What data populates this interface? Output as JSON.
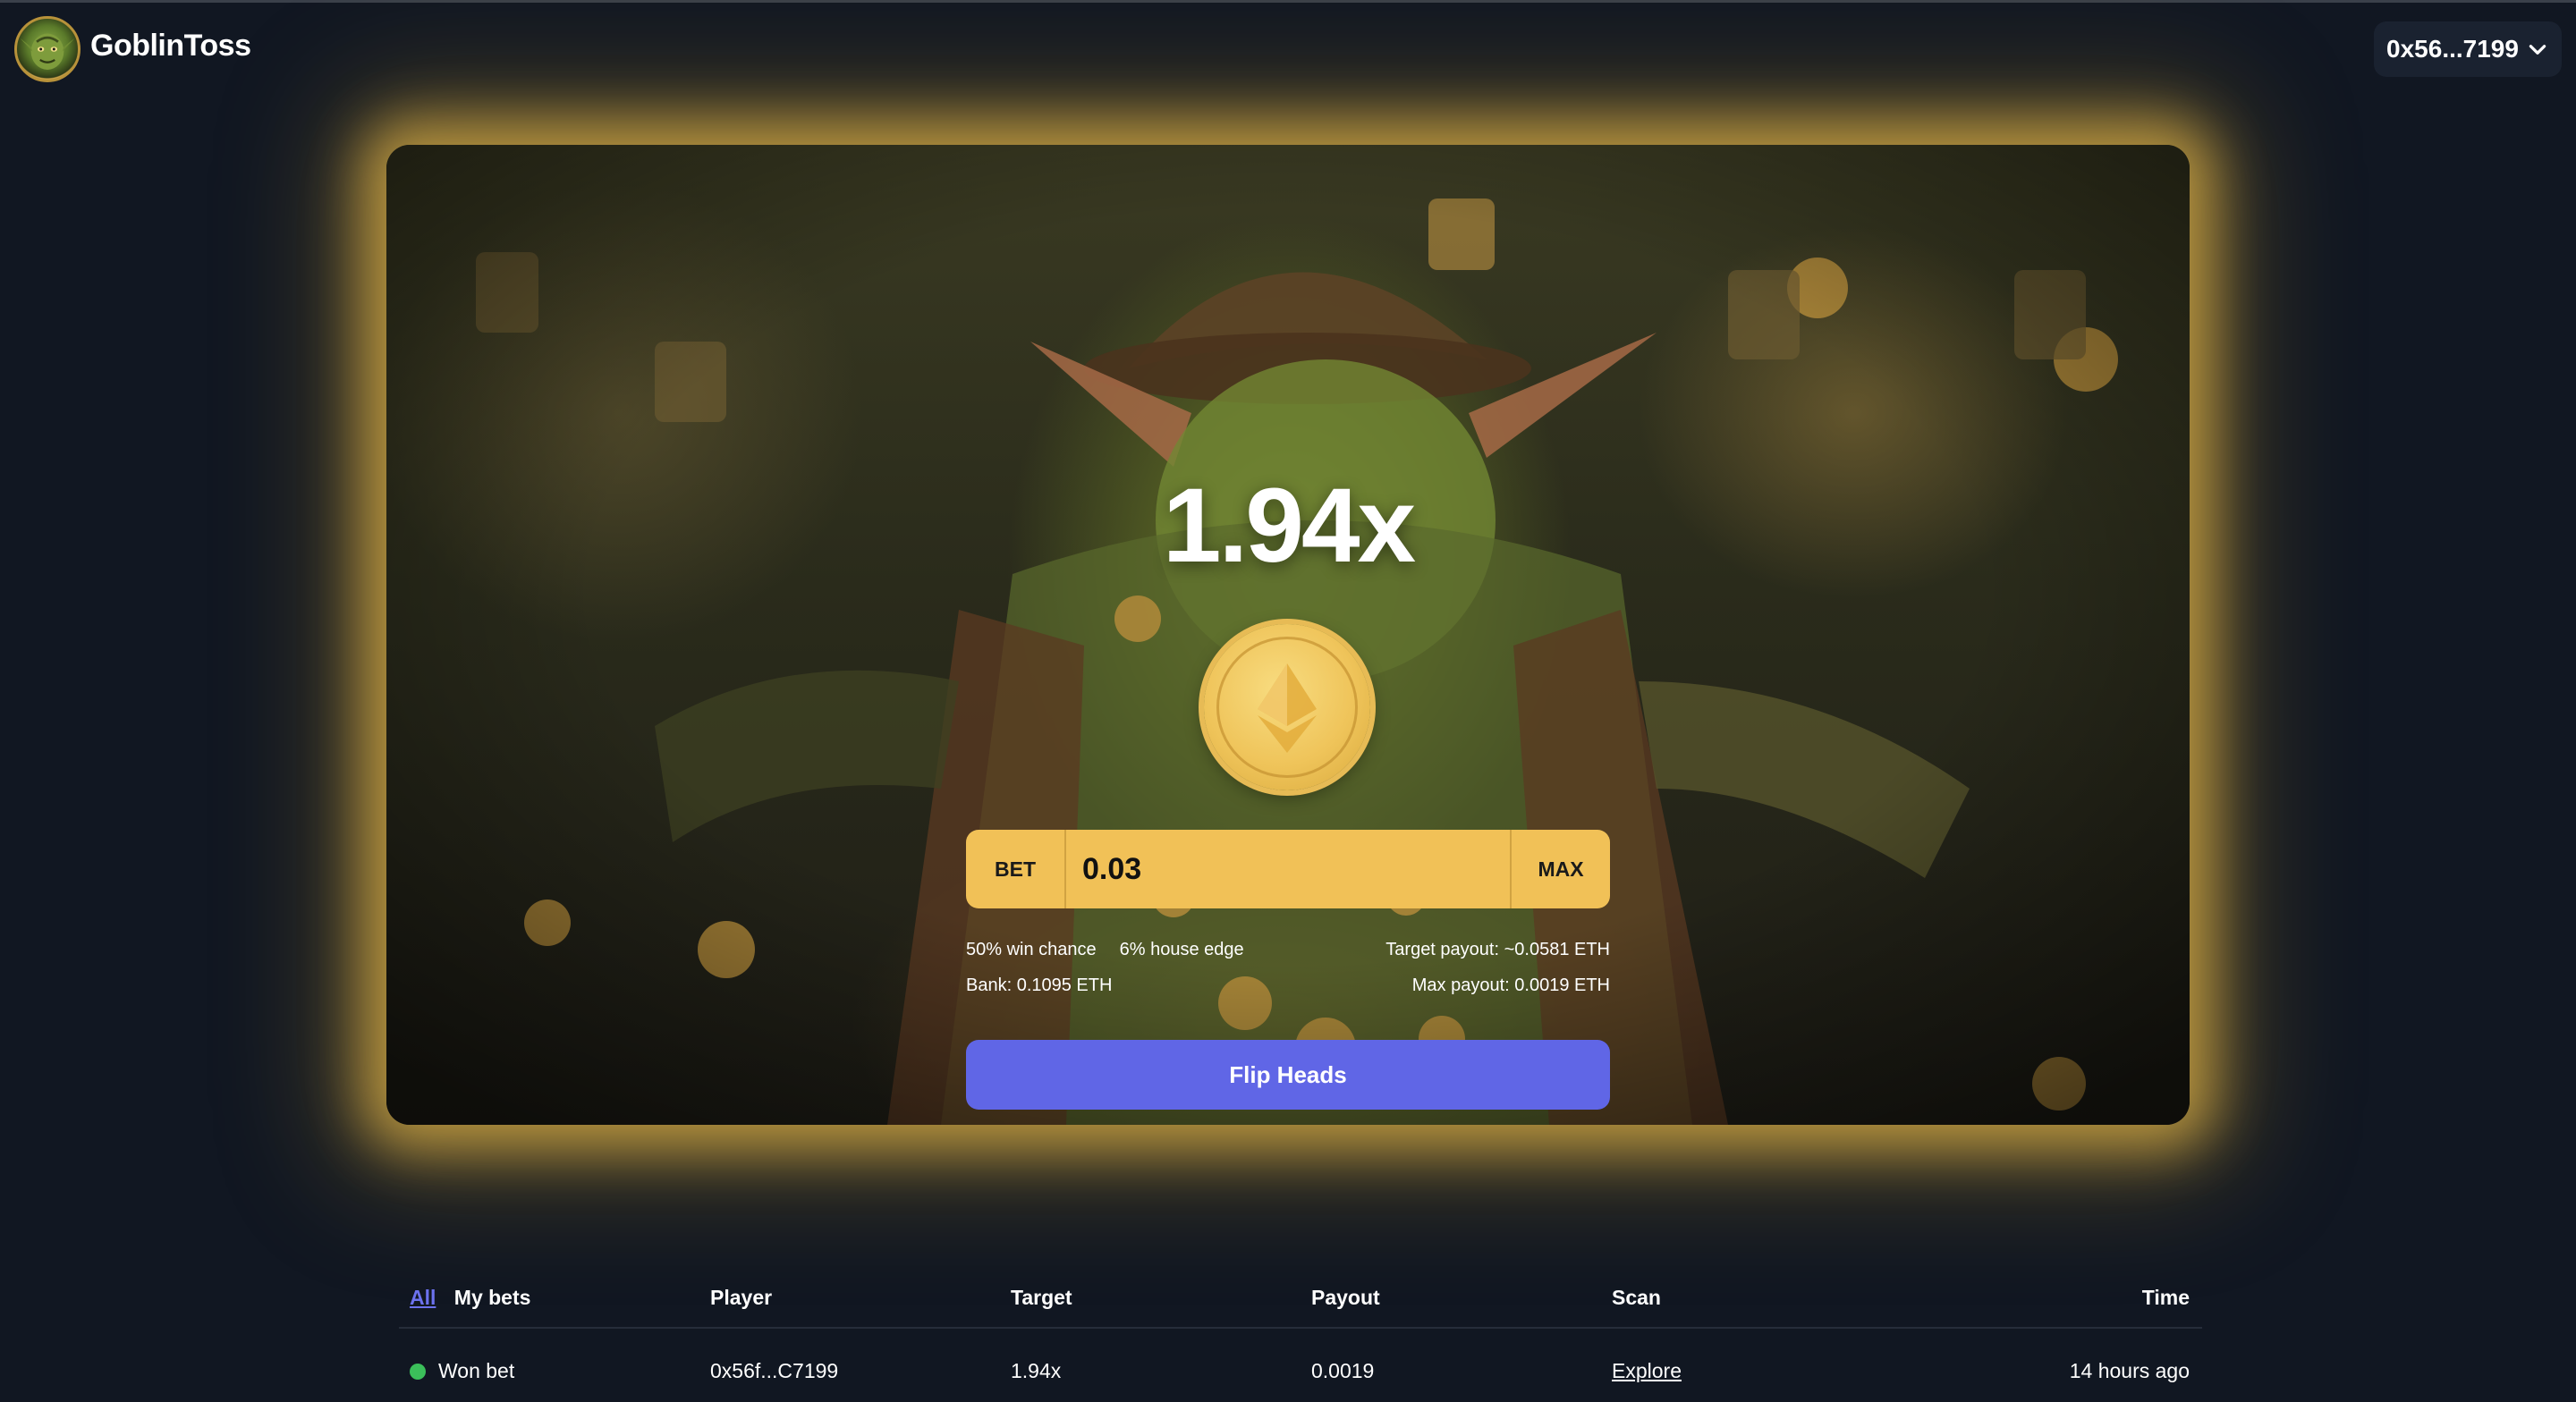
{
  "header": {
    "brand": "GoblinToss",
    "wallet": "0x56...7199"
  },
  "game": {
    "multiplier": "1.94x",
    "bet_label": "BET",
    "bet_value": "0.03",
    "max_label": "MAX",
    "win_chance": "50% win chance",
    "house_edge": "6% house edge",
    "target_payout": "Target payout: ~0.0581 ETH",
    "bank": "Bank: 0.1095 ETH",
    "max_payout": "Max payout: 0.0019 ETH",
    "flip_button": "Flip Heads"
  },
  "colors": {
    "accent": "#6066e6",
    "bet_bar": "#f1c157",
    "glow": "#deb246",
    "background": "#111722",
    "won": "#3bbf5a"
  },
  "table": {
    "tab_all": "All",
    "tab_mine": "My bets",
    "headers": {
      "player": "Player",
      "target": "Target",
      "payout": "Payout",
      "scan": "Scan",
      "time": "Time"
    },
    "rows": [
      {
        "status": "Won bet",
        "player": "0x56f...C7199",
        "target": "1.94x",
        "payout": "0.0019",
        "scan": "Explore",
        "time": "14 hours ago"
      }
    ]
  }
}
